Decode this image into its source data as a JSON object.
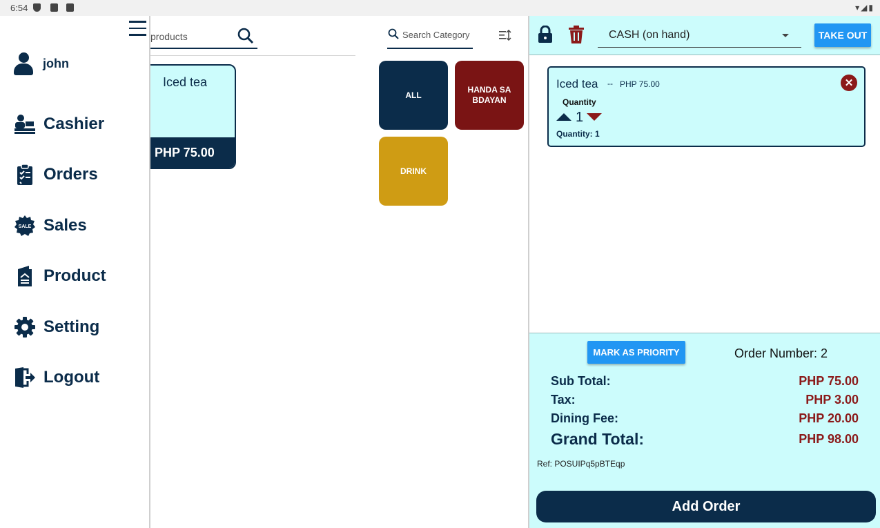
{
  "status_bar": {
    "time": "6:54"
  },
  "sidebar": {
    "user": {
      "name": "john"
    },
    "items": [
      {
        "label": "Cashier",
        "icon": "cashier-icon"
      },
      {
        "label": "Orders",
        "icon": "clipboard-check-icon"
      },
      {
        "label": "Sales",
        "icon": "sale-badge-icon"
      },
      {
        "label": "Product",
        "icon": "product-icon"
      },
      {
        "label": "Setting",
        "icon": "gear-icon"
      },
      {
        "label": "Logout",
        "icon": "logout-icon"
      }
    ]
  },
  "products": {
    "search_placeholder": "products",
    "items": [
      {
        "name": "Iced tea",
        "price": "PHP 75.00"
      }
    ]
  },
  "categories": {
    "search_placeholder": "Search Category",
    "items": [
      {
        "label": "ALL",
        "color": "#0b2c4a"
      },
      {
        "label": "HANDA SA BDAYAN",
        "color": "#7a1414"
      },
      {
        "label": "DRINK",
        "color": "#cf9c14"
      }
    ]
  },
  "order": {
    "payment_method": "CASH (on hand)",
    "order_type_button": "TAKE OUT",
    "items": [
      {
        "name": "Iced tea",
        "separator": "--",
        "price": "PHP 75.00",
        "quantity_label": "Quantity",
        "quantity": "1",
        "quantity_summary": "Quantity: 1"
      }
    ]
  },
  "summary": {
    "priority_button": "MARK AS PRIORITY",
    "order_number": "Order Number: 2",
    "sub_total_label": "Sub Total:",
    "sub_total": "PHP 75.00",
    "tax_label": "Tax:",
    "tax": "PHP 3.00",
    "dining_fee_label": "Dining Fee:",
    "dining_fee": "PHP 20.00",
    "grand_total_label": "Grand Total:",
    "grand_total": "PHP 98.00",
    "ref": "Ref: POSUIPq5pBTEqp",
    "add_order_button": "Add Order"
  },
  "colors": {
    "navy": "#0b2c4a",
    "maroon": "#8b1a1a",
    "accent_blue": "#2196f3",
    "panel_cyan": "#ccfcfc"
  }
}
